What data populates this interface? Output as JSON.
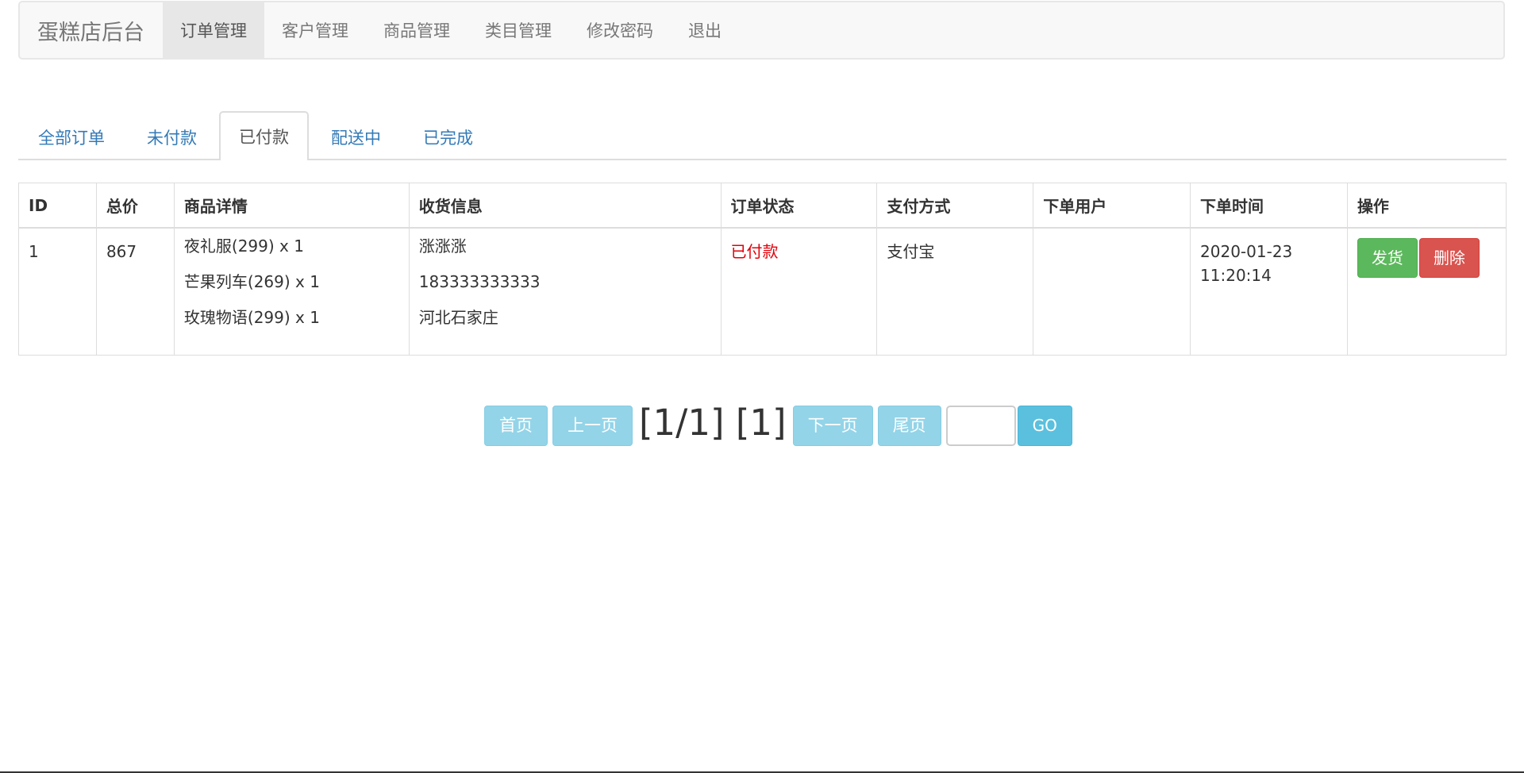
{
  "navbar": {
    "brand": "蛋糕店后台",
    "items": [
      {
        "label": "订单管理",
        "active": true
      },
      {
        "label": "客户管理",
        "active": false
      },
      {
        "label": "商品管理",
        "active": false
      },
      {
        "label": "类目管理",
        "active": false
      },
      {
        "label": "修改密码",
        "active": false
      },
      {
        "label": "退出",
        "active": false
      }
    ]
  },
  "tabs": [
    {
      "label": "全部订单",
      "active": false
    },
    {
      "label": "未付款",
      "active": false
    },
    {
      "label": "已付款",
      "active": true
    },
    {
      "label": "配送中",
      "active": false
    },
    {
      "label": "已完成",
      "active": false
    }
  ],
  "table": {
    "headers": [
      "ID",
      "总价",
      "商品详情",
      "收货信息",
      "订单状态",
      "支付方式",
      "下单用户",
      "下单时间",
      "操作"
    ],
    "rows": [
      {
        "id": "1",
        "total": "867",
        "items": [
          "夜礼服(299) x 1",
          "芒果列车(269) x 1",
          "玫瑰物语(299) x 1"
        ],
        "shipping": {
          "name": "涨涨涨",
          "phone": "183333333333",
          "address": "河北石家庄"
        },
        "status": "已付款",
        "payment": "支付宝",
        "user": "",
        "time_date": "2020-01-23",
        "time_clock": "11:20:14",
        "actions": {
          "ship": "发货",
          "delete": "删除"
        }
      }
    ]
  },
  "pagination": {
    "first": "首页",
    "prev": "上一页",
    "info": "[1/1] [1]",
    "next": "下一页",
    "last": "尾页",
    "input_value": "",
    "go": "GO"
  },
  "colors": {
    "status_red": "#e1000a",
    "link_blue": "#337ab7",
    "success": "#5cb85c",
    "danger": "#d9534f",
    "info": "#5bc0de"
  }
}
